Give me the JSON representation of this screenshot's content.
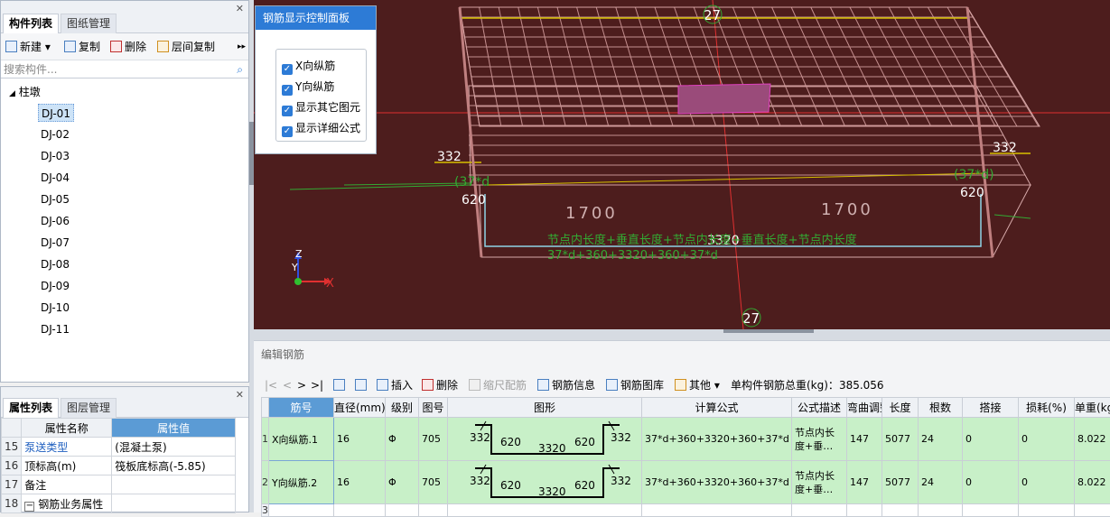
{
  "component_panel": {
    "tabs": [
      "构件列表",
      "图纸管理"
    ],
    "toolbar": {
      "new": "新建",
      "copy": "复制",
      "delete": "删除",
      "floor_copy": "层间复制",
      "more": "▸▸"
    },
    "search_placeholder": "搜索构件...",
    "tree_root": "柱墩",
    "items": [
      "DJ-01",
      "DJ-02",
      "DJ-03",
      "DJ-04",
      "DJ-05",
      "DJ-06",
      "DJ-07",
      "DJ-08",
      "DJ-09",
      "DJ-10",
      "DJ-11"
    ],
    "selected": "DJ-01"
  },
  "property_panel": {
    "tabs": [
      "属性列表",
      "图层管理"
    ],
    "header": {
      "name": "属性名称",
      "value": "属性值"
    },
    "rows": [
      {
        "num": "15",
        "name": "泵送类型",
        "value": "(混凝土泵)"
      },
      {
        "num": "16",
        "name": "顶标高(m)",
        "value": "筏板底标高(-5.85)"
      },
      {
        "num": "17",
        "name": "备注",
        "value": ""
      },
      {
        "num": "18",
        "name": "钢筋业务属性",
        "value": "",
        "expander": "−"
      }
    ]
  },
  "control_panel": {
    "title": "钢筋显示控制面板",
    "options": [
      "X向纵筋",
      "Y向纵筋",
      "显示其它图元",
      "显示详细公式"
    ]
  },
  "viewport": {
    "dims": {
      "top": "27",
      "bottom": "27",
      "left_h": "332",
      "right_h": "332",
      "left_w": "620",
      "right_w": "620",
      "length": "3320",
      "seg_left": "1700",
      "seg_right": "1700",
      "left_note": "(37*d",
      "right_note": "(37*d)"
    },
    "formula_line1": "节点内长度+垂直长度+节点内长度+垂直长度+节点内长度",
    "formula_line2": "37*d+360+3320+360+37*d",
    "axis_labels": {
      "x": "X",
      "y": "Y",
      "z": "Z"
    }
  },
  "edit_rebar": {
    "title": "编辑钢筋",
    "nav": [
      "|<",
      "<",
      ">",
      ">|"
    ],
    "toolbar": {
      "insert": "插入",
      "delete": "删除",
      "scale": "缩尺配筋",
      "info": "钢筋信息",
      "library": "钢筋图库",
      "other": "其他",
      "total_label": "单构件钢筋总重(kg)：",
      "total_value": "385.056"
    },
    "columns": [
      "筋号",
      "直径(mm)",
      "级别",
      "图号",
      "图形",
      "计算公式",
      "公式描述",
      "弯曲调整",
      "长度",
      "根数",
      "搭接",
      "损耗(%)",
      "单重(kg)"
    ],
    "rows": [
      {
        "num": "1",
        "name": "X向纵筋.1",
        "dia": "16",
        "grade": "Φ",
        "fig": "705",
        "shape": {
          "a": "332",
          "b": "620",
          "c": "3320",
          "d": "620",
          "e": "332"
        },
        "formula": "37*d+360+3320+360+37*d",
        "desc": "节点内长度+垂…",
        "bend": "147",
        "len": "5077",
        "count": "24",
        "lap": "0",
        "loss": "0",
        "weight": "8.022"
      },
      {
        "num": "2",
        "name": "Y向纵筋.2",
        "dia": "16",
        "grade": "Φ",
        "fig": "705",
        "shape": {
          "a": "332",
          "b": "620",
          "c": "3320",
          "d": "620",
          "e": "332"
        },
        "formula": "37*d+360+3320+360+37*d",
        "desc": "节点内长度+垂…",
        "bend": "147",
        "len": "5077",
        "count": "24",
        "lap": "0",
        "loss": "0",
        "weight": "8.022"
      },
      {
        "num": "3"
      }
    ]
  }
}
